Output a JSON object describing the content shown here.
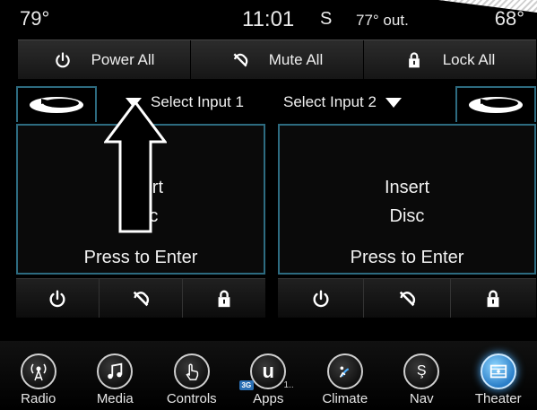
{
  "status": {
    "left_temp": "79°",
    "time": "11:01",
    "compass": "S",
    "outside_temp": "77° out.",
    "right_temp": "68°"
  },
  "global_controls": [
    {
      "label": "Power All",
      "icon": "power-icon"
    },
    {
      "label": "Mute All",
      "icon": "mute-icon"
    },
    {
      "label": "Lock All",
      "icon": "lock-icon"
    }
  ],
  "panels": [
    {
      "select_label": "Select Input 1",
      "line1": "Insert",
      "line2": "Disc",
      "line3": "Press to Enter",
      "logo": "bluray-disc-icon"
    },
    {
      "select_label": "Select Input 2",
      "line1": "Insert",
      "line2": "Disc",
      "line3": "Press to Enter",
      "logo": "bluray-disc-icon"
    }
  ],
  "nav": [
    {
      "label": "Radio",
      "icon": "radio-icon"
    },
    {
      "label": "Media",
      "icon": "music-note-icon"
    },
    {
      "label": "Controls",
      "icon": "hand-touch-icon"
    },
    {
      "label": "Apps",
      "icon": "uconnect-icon",
      "badge": "3G",
      "extra": "1.."
    },
    {
      "label": "Climate",
      "icon": "climate-icon"
    },
    {
      "label": "Nav",
      "icon": "compass-icon"
    },
    {
      "label": "Theater",
      "icon": "film-icon",
      "active": true
    }
  ],
  "colors": {
    "panel_border": "#2d6b80",
    "active_tab": "#2a7ec8"
  }
}
